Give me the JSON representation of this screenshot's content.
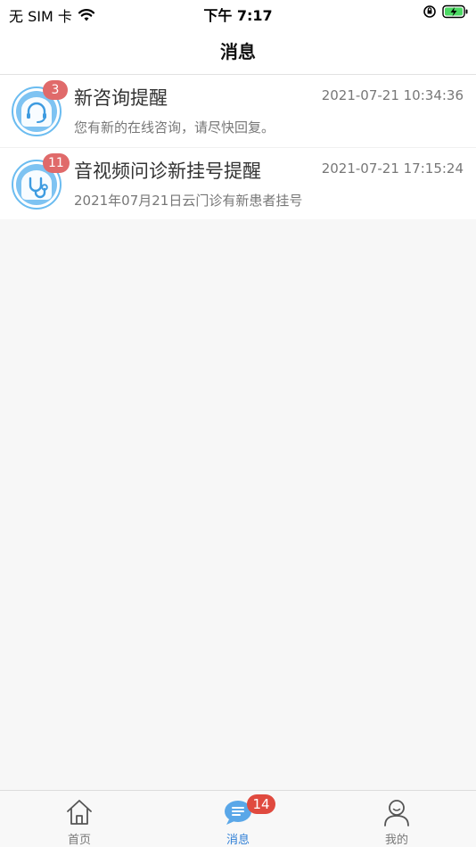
{
  "status_bar": {
    "carrier": "无 SIM 卡",
    "time": "下午 7:17"
  },
  "nav": {
    "title": "消息"
  },
  "messages": [
    {
      "title": "新咨询提醒",
      "time": "2021-07-21 10:34:36",
      "desc": "您有新的在线咨询，请尽快回复。",
      "badge": "3",
      "icon": "headset-icon"
    },
    {
      "title": "音视频问诊新挂号提醒",
      "time": "2021-07-21 17:15:24",
      "desc": "2021年07月21日云门诊有新患者挂号",
      "badge": "11",
      "icon": "stethoscope-icon"
    }
  ],
  "tabbar": {
    "home": "首页",
    "messages": "消息",
    "messages_badge": "14",
    "mine": "我的"
  },
  "colors": {
    "accent": "#2f7fd6",
    "badge": "#e06a6a",
    "tab_badge": "#e04a3f",
    "avatar_blue": "#6bbcf0"
  }
}
